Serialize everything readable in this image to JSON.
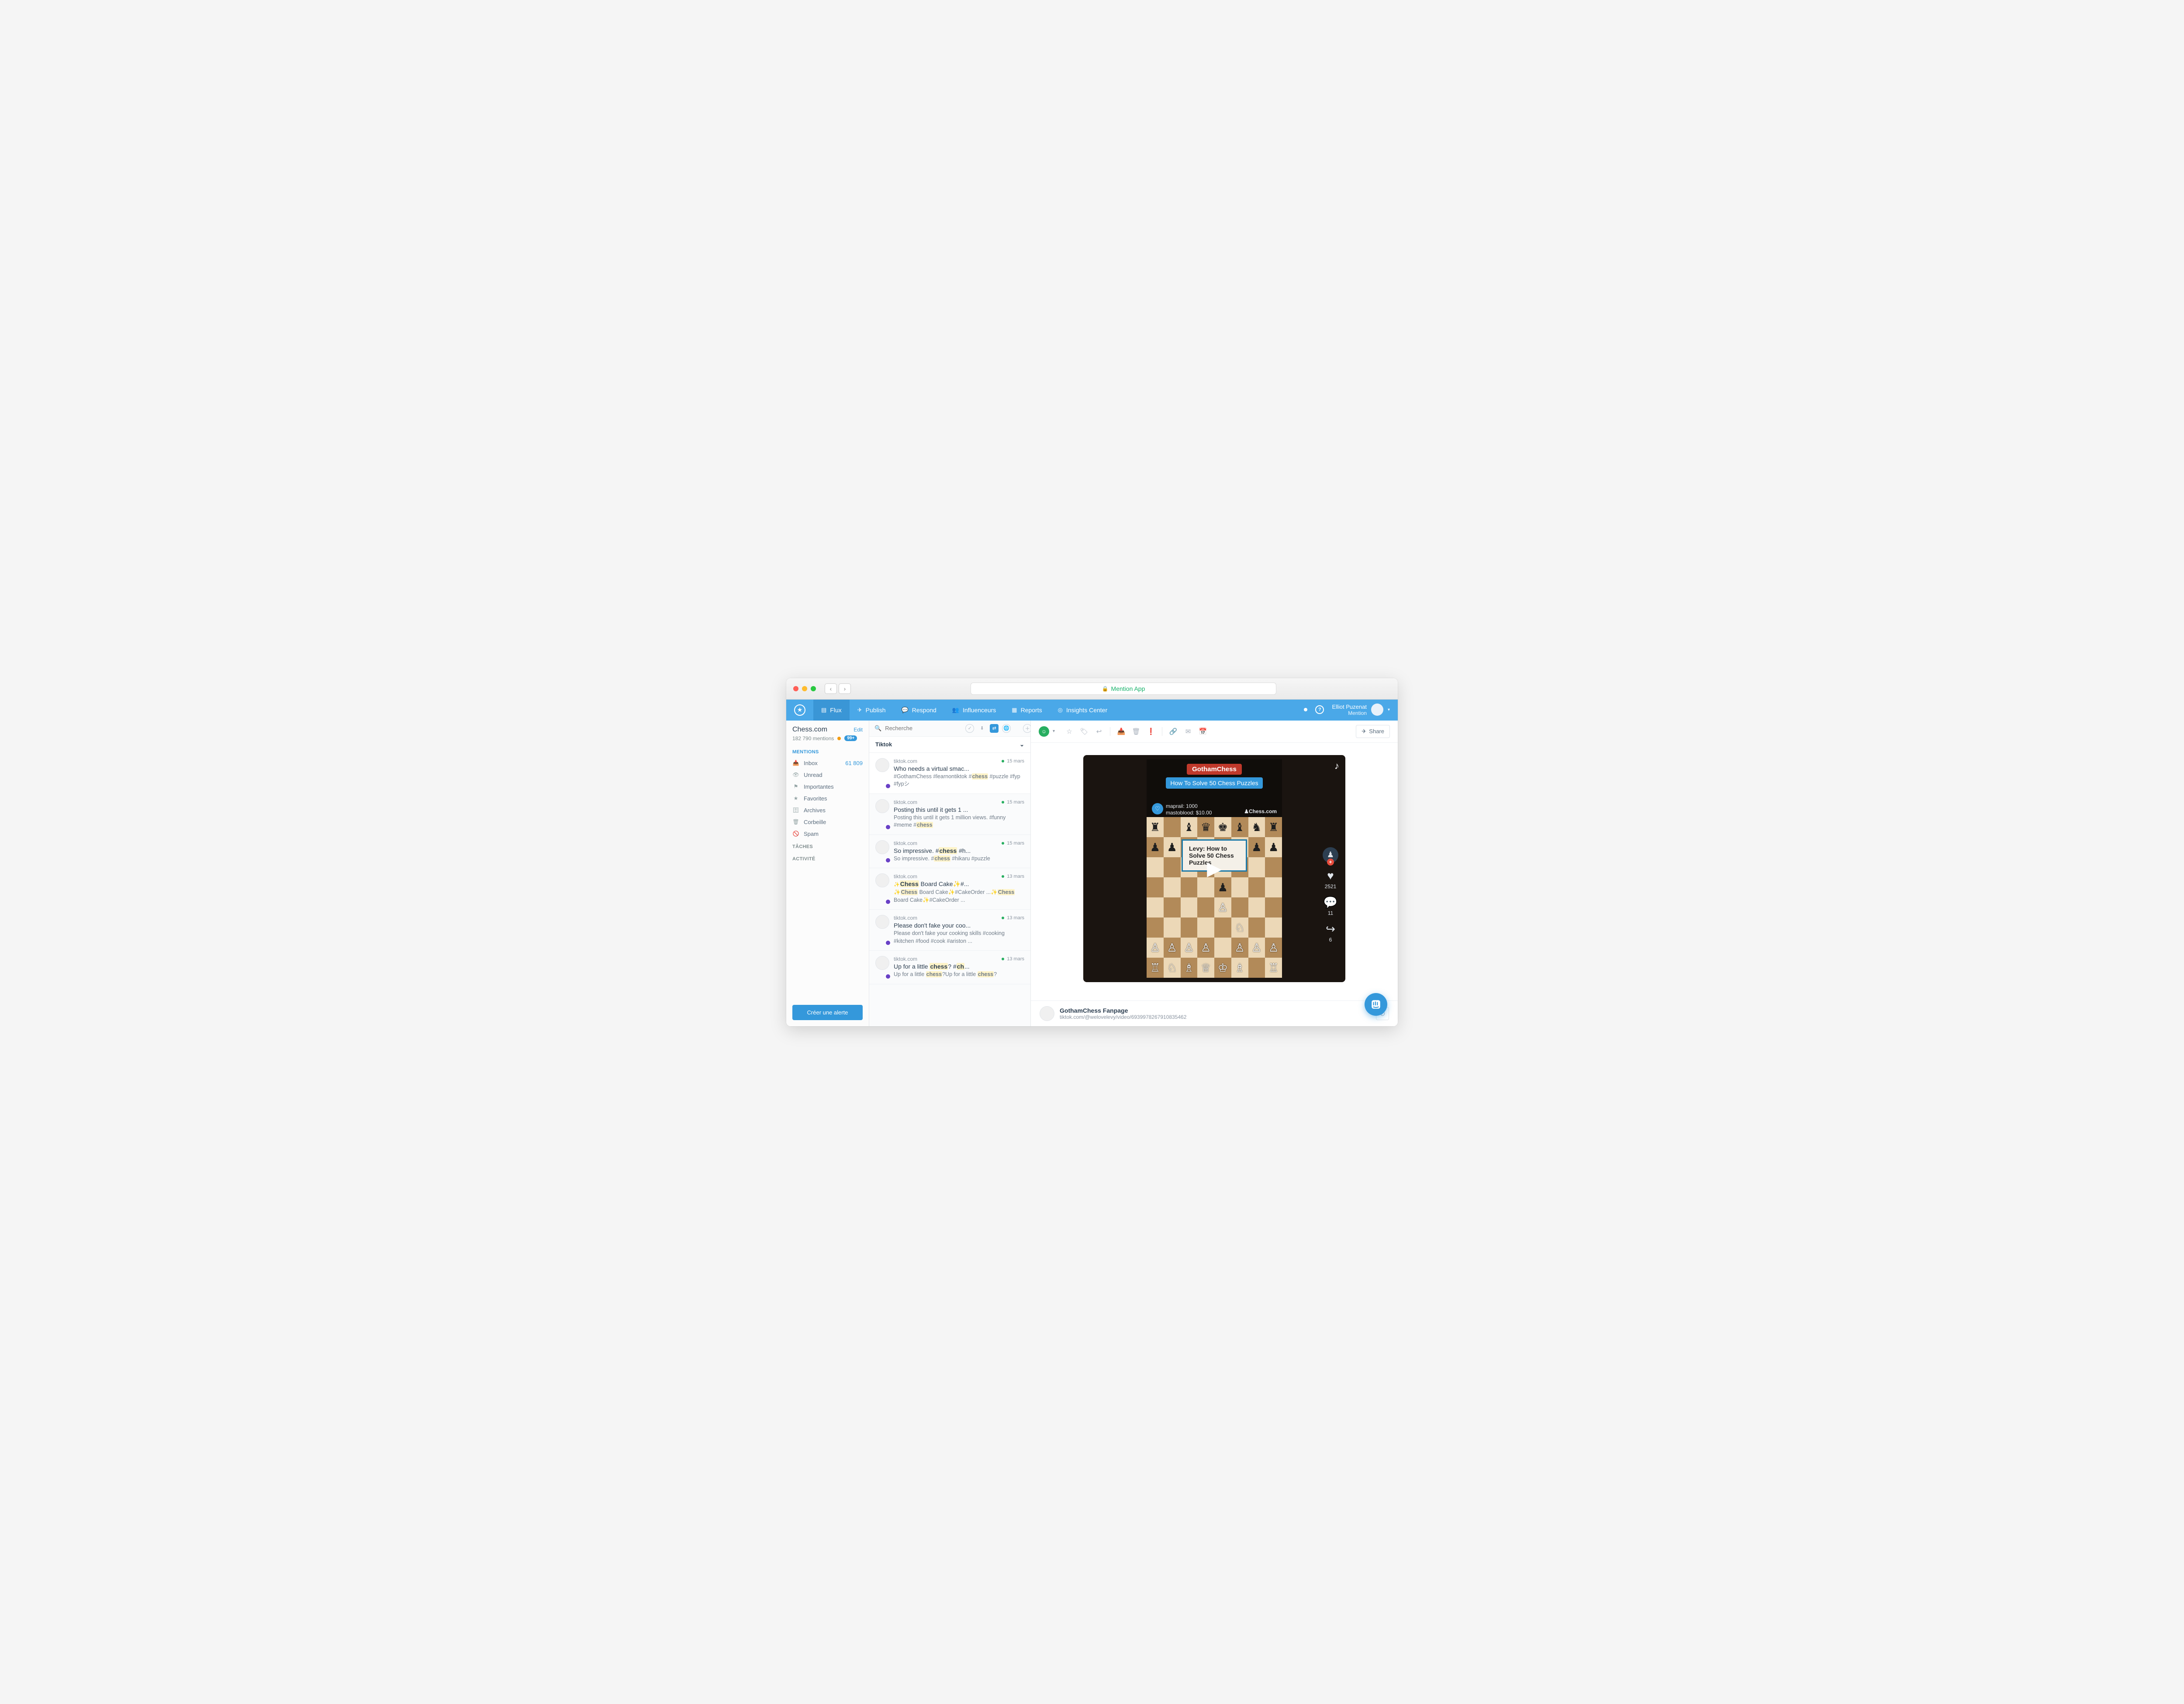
{
  "titlebar": {
    "url_label": "Mention App"
  },
  "nav": {
    "items": [
      {
        "label": "Flux",
        "icon": "feed"
      },
      {
        "label": "Publish",
        "icon": "send"
      },
      {
        "label": "Respond",
        "icon": "chat"
      },
      {
        "label": "Influenceurs",
        "icon": "people"
      },
      {
        "label": "Reports",
        "icon": "chart"
      },
      {
        "label": "Insights Center",
        "icon": "compass"
      }
    ],
    "user": {
      "name": "Elliot Puzenat",
      "org": "Mention"
    }
  },
  "sidebar": {
    "alert_title": "Chess.com",
    "edit_label": "Edit",
    "mentions_count": "182 790 mentions",
    "count_badge": "99+",
    "sections": {
      "mentions_label": "MENTIONS",
      "tasks_label": "TÂCHES",
      "activity_label": "ACTIVITÉ"
    },
    "items": [
      {
        "label": "Inbox",
        "count": "61 809",
        "icon": "inbox"
      },
      {
        "label": "Unread",
        "icon": "eye"
      },
      {
        "label": "Importantes",
        "icon": "flag"
      },
      {
        "label": "Favorites",
        "icon": "star"
      },
      {
        "label": "Archives",
        "icon": "archive"
      },
      {
        "label": "Corbeille",
        "icon": "trash"
      },
      {
        "label": "Spam",
        "icon": "ban"
      }
    ],
    "create_alert_label": "Créer une alerte"
  },
  "mention_list": {
    "search_placeholder": "Recherche",
    "filter_label": "Tiktok",
    "items": [
      {
        "source": "tiktok.com",
        "date": "15 mars",
        "title": "Who needs a virtual smac...",
        "excerpt_pre": "#GothamChess #learnontiktok #",
        "excerpt_hl1": "chess",
        "excerpt_post": " #puzzle #fyp #fypシ"
      },
      {
        "source": "tiktok.com",
        "date": "15 mars",
        "title": "Posting this until it gets 1 ...",
        "excerpt_pre": "Posting this until it gets 1 million views. #funny #meme #",
        "excerpt_hl1": "chess",
        "excerpt_post": ""
      },
      {
        "source": "tiktok.com",
        "date": "15 mars",
        "title_pre": "So impressive. #",
        "title_hl": "chess",
        "title_post": " #h...",
        "excerpt_pre": "So impressive. #",
        "excerpt_hl1": "chess",
        "excerpt_post": " #hikaru #puzzle"
      },
      {
        "source": "tiktok.com",
        "date": "13 mars",
        "title_pre": "✨",
        "title_hl": "Chess",
        "title_post": " Board Cake✨#...",
        "excerpt_pre": "✨",
        "excerpt_hl1": "Chess",
        "excerpt_mid": " Board Cake✨#CakeOrder ...✨",
        "excerpt_hl2": "Chess",
        "excerpt_post": " Board Cake✨#CakeOrder ..."
      },
      {
        "source": "tiktok.com",
        "date": "13 mars",
        "title": "Please don't fake your coo...",
        "excerpt_pre": "Please don't fake your cooking skills #cooking #kitchen #food #cook #ariston ...",
        "excerpt_hl1": "",
        "excerpt_post": ""
      },
      {
        "source": "tiktok.com",
        "date": "13 mars",
        "title_pre": "Up for a little ",
        "title_hl": "chess",
        "title_mid": "? #",
        "title_hl2": "ch",
        "title_post": "...",
        "excerpt_pre": "Up for a little ",
        "excerpt_hl1": "chess",
        "excerpt_mid": "?Up for a little ",
        "excerpt_hl2": "chess",
        "excerpt_post": "?"
      }
    ]
  },
  "detail": {
    "share_label": "Share",
    "video": {
      "channel_badge": "GothamChess",
      "subtitle_badge": "How To Solve 50 Chess Puzzles",
      "donor1": "maprail: 1000",
      "donor2": "mastoblood: $10.00",
      "chesscom": "♟Chess.com",
      "levy_text": "Levy: How to Solve 50 Chess Puzzles",
      "like_count": "2521",
      "comment_count": "11",
      "share_count": "6"
    },
    "footer": {
      "title": "GothamChess Fanpage",
      "url": "tiktok.com/@welovelevy/video/6939978267910835462"
    }
  }
}
